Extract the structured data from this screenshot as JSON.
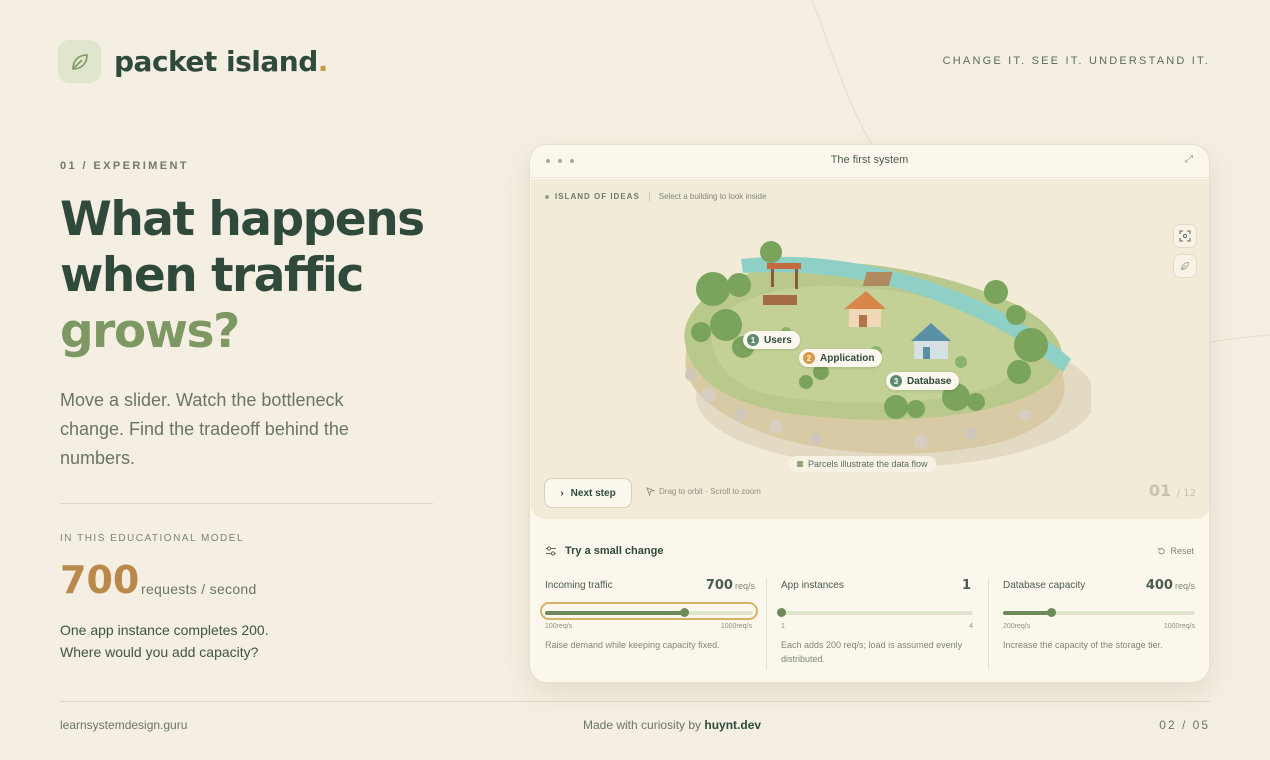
{
  "brand": {
    "name": "packet island",
    "dot": "."
  },
  "tagline": "CHANGE IT. SEE IT. UNDERSTAND IT.",
  "experiment": {
    "eyebrow": "01 / EXPERIMENT",
    "headline_line1": "What happens",
    "headline_line2": "when traffic",
    "headline_accent": "grows?",
    "lede": "Move a slider. Watch the bottleneck change. Find the tradeoff behind the numbers.",
    "model_label": "IN THIS EDUCATIONAL MODEL",
    "big_number": "700",
    "big_unit": "requests / second",
    "note_line1": "One app instance completes 200.",
    "note_line2": "Where would you add capacity?"
  },
  "window": {
    "title": "The first system",
    "scene_label": "ISLAND OF IDEAS",
    "scene_hint": "Select a building to look inside",
    "pins": [
      {
        "num": "1",
        "label": "Users",
        "color": "#5d8a6a"
      },
      {
        "num": "2",
        "label": "Application",
        "color": "#d89a43"
      },
      {
        "num": "3",
        "label": "Database",
        "color": "#5d8a6a"
      }
    ],
    "parcel_note": "Parcels illustrate the data flow",
    "next_label": "Next step",
    "orbit_hint": "Drag to orbit · Scroll to zoom",
    "step_current": "01",
    "step_total": "/ 12"
  },
  "controls": {
    "title": "Try a small change",
    "reset": "Reset",
    "sliders": [
      {
        "title": "Incoming traffic",
        "value": "700",
        "unit": "req/s",
        "min": "100req/s",
        "max": "1000req/s",
        "level": 0.6667,
        "desc": "Raise demand while keeping capacity fixed."
      },
      {
        "title": "App instances",
        "value": "1",
        "unit": "",
        "min": "1",
        "max": "4",
        "level": 0.0,
        "desc": "Each adds 200 req/s; load is assumed evenly distributed."
      },
      {
        "title": "Database capacity",
        "value": "400",
        "unit": "req/s",
        "min": "200req/s",
        "max": "1000req/s",
        "level": 0.25,
        "desc": "Increase the capacity of the storage tier."
      }
    ]
  },
  "footer": {
    "left": "learnsystemdesign.guru",
    "made_prefix": "Made with curiosity by ",
    "made_author": "huynt.dev",
    "page": "02 / 05"
  },
  "colors": {
    "primary": "#2f4a3a",
    "accent": "#7e9863",
    "gold": "#b8894a",
    "background": "#f4efe2"
  }
}
